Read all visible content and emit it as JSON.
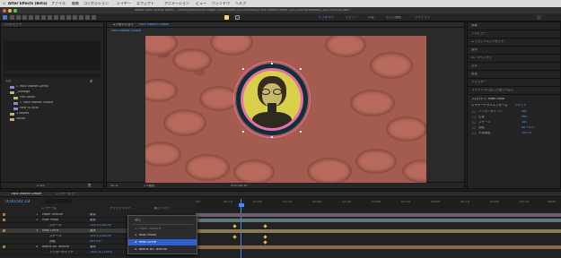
{
  "menubar": {
    "app": "After Effects (Beta)",
    "items": [
      "ファイル",
      "編集",
      "コンポジション",
      "レイヤー",
      "エフェクト",
      "アニメーション",
      "ビュー",
      "ウィンドウ",
      "ヘルプ"
    ]
  },
  "window": {
    "title": "Adobe After Effects (Beta) - /Users/adamduke/Google Drive/Adobe/2021090/NAB/Track Mattes Demo 2021-09/TrackMattes_2021090104.aep *"
  },
  "workspaces": [
    "デフォルト",
    "レビュー",
    "学習",
    "小さい画面",
    "ライブラリ"
  ],
  "project": {
    "tab": "プロジェクト",
    "name_header": "名前",
    "items": [
      {
        "name": "1 Track Mattes Demo",
        "type": "comp"
      },
      {
        "name": "_Footage",
        "type": "folder"
      },
      {
        "name": "PreComps",
        "type": "folder"
      },
      {
        "name": "1 Track Mattes Simple",
        "type": "comp"
      },
      {
        "name": "How To Intro",
        "type": "comp"
      },
      {
        "name": "3 Assets",
        "type": "folder"
      },
      {
        "name": "Solids",
        "type": "folder"
      }
    ],
    "bpc": "8 bpc"
  },
  "viewer": {
    "tab": "コンポジション",
    "comp_name": "Track Mattes Simple",
    "breadcrumb": "Track Mattes Simple",
    "zoom": "50 %",
    "timecode": "0;00;00;19",
    "resolution": "フル画質"
  },
  "right_panels": {
    "items": [
      "情報",
      "プレビュー",
      "エフェクト&プリセット",
      "整列",
      "CC ライブラリ",
      "文字",
      "段落",
      "トラッカー",
      "コンテンツに応じた塗りつぶし"
    ],
    "properties": {
      "title": "プロパティ: Host Circle",
      "section": "レイヤートランスフォーム",
      "reset": "リセット",
      "rows": [
        {
          "label": "アンカーポイント",
          "value": "960"
        },
        {
          "label": "位置",
          "value": "960"
        },
        {
          "label": "スケール",
          "value": "100"
        },
        {
          "label": "回転",
          "value": "0x +0.0°"
        },
        {
          "label": "不透明度",
          "value": "100 %"
        }
      ]
    }
  },
  "timeline": {
    "tab": "Track Mattes Simple",
    "render_tab": "レンダーキュー",
    "timecode": "0;00;00;19",
    "column_layer": "レイヤー名",
    "column_track": "トラックマット",
    "column_parent": "親とリンク",
    "layers": [
      {
        "num": "1",
        "name": "Paper Texture",
        "mode": "乗算"
      },
      {
        "num": "2",
        "name": "Host Photo",
        "mode": "乗算"
      },
      {
        "num": "",
        "name": "スケール",
        "value": "124.0,124.0%"
      },
      {
        "num": "3",
        "name": "Host Circle",
        "mode": "通常"
      },
      {
        "num": "",
        "name": "スケール",
        "value": "124.0,124.0%"
      },
      {
        "num": "",
        "name": "回転",
        "value": "0x+0.0°"
      },
      {
        "num": "4",
        "name": "Beans BG Texture",
        "mode": "通常"
      },
      {
        "num": "",
        "name": "アンカーポイント",
        "value": "2592.0,1728.0"
      }
    ],
    "ruler": [
      "00f",
      "00:12f",
      "01:00f",
      "01:12f",
      "02:00f",
      "02:12f",
      "03:00f",
      "03:12f",
      "04:00f",
      "04:12f",
      "05:00f",
      "05:12f",
      "06:00"
    ]
  },
  "dropdown": {
    "items": [
      {
        "label": "なし",
        "state": "normal"
      },
      {
        "label": "1. Paper Texture",
        "state": "dim"
      },
      {
        "label": "2. Host Photo",
        "state": "normal"
      },
      {
        "label": "3. Host Circle",
        "state": "selected"
      },
      {
        "label": "4. Beans BG Texture",
        "state": "normal"
      }
    ]
  },
  "colors": {
    "accent": "#2f5fd1",
    "timecode_blue": "#5aa6ff",
    "matte_pink": "#e86fa8",
    "tint_yellow": "#d8d04a",
    "ring_dark": "#0f2f3a"
  }
}
